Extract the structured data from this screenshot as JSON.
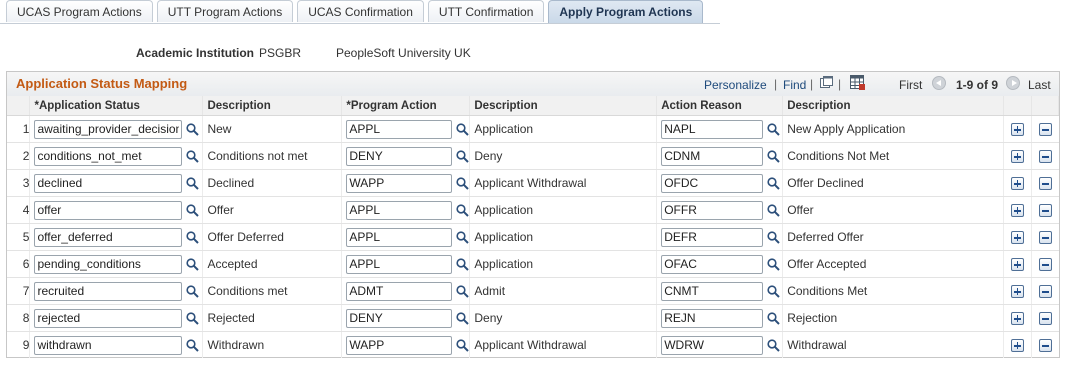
{
  "tabs": [
    {
      "label": "UCAS Program Actions",
      "active": false
    },
    {
      "label": "UTT Program Actions",
      "active": false
    },
    {
      "label": "UCAS Confirmation",
      "active": false
    },
    {
      "label": "UTT Confirmation",
      "active": false
    },
    {
      "label": "Apply Program Actions",
      "active": true
    }
  ],
  "header": {
    "institution_label": "Academic Institution",
    "institution_code": "PSGBR",
    "institution_name": "PeopleSoft University UK"
  },
  "grid": {
    "title": "Application Status Mapping",
    "personalize": "Personalize",
    "find": "Find",
    "first": "First",
    "range": "1-9 of 9",
    "last": "Last",
    "columns": {
      "app_status": "*Application Status",
      "description": "Description",
      "program_action": "*Program Action",
      "description2": "Description",
      "action_reason": "Action Reason",
      "description3": "Description"
    },
    "rows": [
      {
        "num": "1",
        "status": "awaiting_provider_decision",
        "status_desc": "New",
        "action": "APPL",
        "action_desc": "Application",
        "reason": "NAPL",
        "reason_desc": "New Apply Application"
      },
      {
        "num": "2",
        "status": "conditions_not_met",
        "status_desc": "Conditions not met",
        "action": "DENY",
        "action_desc": "Deny",
        "reason": "CDNM",
        "reason_desc": "Conditions Not Met"
      },
      {
        "num": "3",
        "status": "declined",
        "status_desc": "Declined",
        "action": "WAPP",
        "action_desc": "Applicant Withdrawal",
        "reason": "OFDC",
        "reason_desc": "Offer Declined"
      },
      {
        "num": "4",
        "status": "offer",
        "status_desc": "Offer",
        "action": "APPL",
        "action_desc": "Application",
        "reason": "OFFR",
        "reason_desc": "Offer"
      },
      {
        "num": "5",
        "status": "offer_deferred",
        "status_desc": "Offer Deferred",
        "action": "APPL",
        "action_desc": "Application",
        "reason": "DEFR",
        "reason_desc": "Deferred Offer"
      },
      {
        "num": "6",
        "status": "pending_conditions",
        "status_desc": "Accepted",
        "action": "APPL",
        "action_desc": "Application",
        "reason": "OFAC",
        "reason_desc": "Offer Accepted"
      },
      {
        "num": "7",
        "status": "recruited",
        "status_desc": "Conditions met",
        "action": "ADMT",
        "action_desc": "Admit",
        "reason": "CNMT",
        "reason_desc": "Conditions Met"
      },
      {
        "num": "8",
        "status": "rejected",
        "status_desc": "Rejected",
        "action": "DENY",
        "action_desc": "Deny",
        "reason": "REJN",
        "reason_desc": "Rejection"
      },
      {
        "num": "9",
        "status": "withdrawn",
        "status_desc": "Withdrawn",
        "action": "WAPP",
        "action_desc": "Applicant Withdrawal",
        "reason": "WDRW",
        "reason_desc": "Withdrawal"
      }
    ]
  },
  "icons": {
    "lookup": "magnifier-icon",
    "add_row": "plus-icon",
    "delete_row": "minus-icon",
    "view_all": "new-window-icon",
    "download": "spreadsheet-icon"
  }
}
